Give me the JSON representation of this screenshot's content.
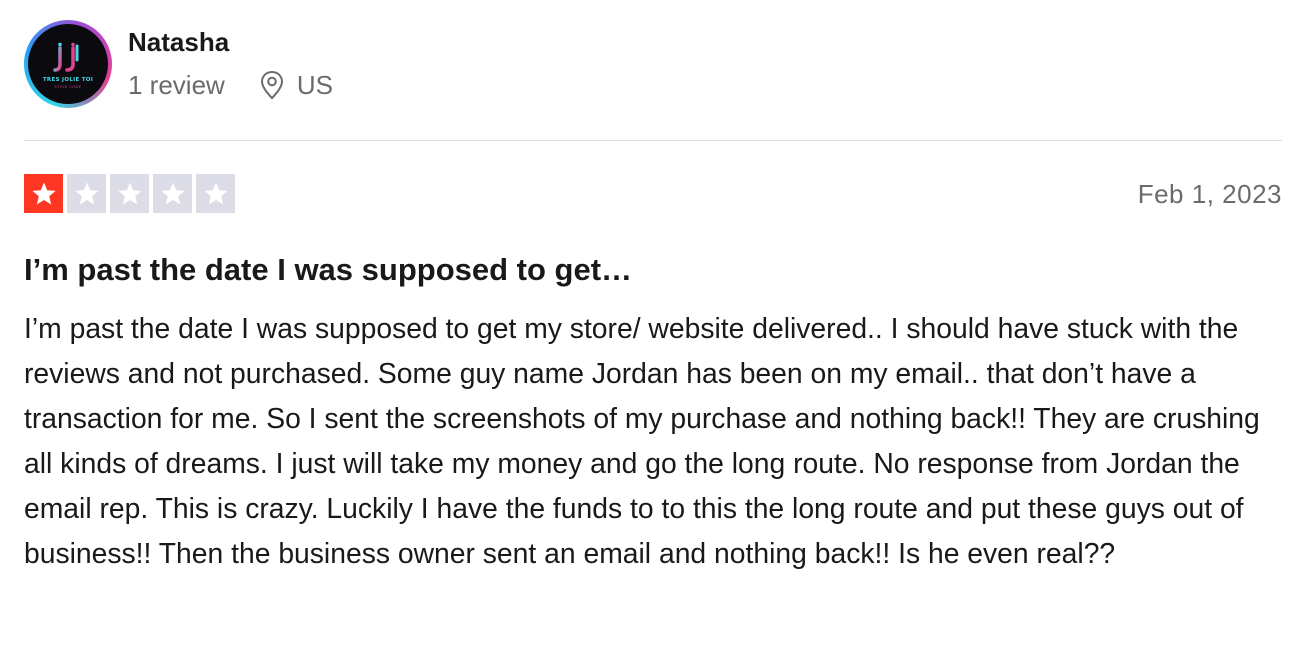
{
  "consumer": {
    "name": "Natasha",
    "review_count": "1 review",
    "country": "US",
    "avatar": {
      "icon": "brand-logo-avatar",
      "brand_text": "TRES JOLIE TOI",
      "sub_text": "STYLE CODE",
      "ring_colors": [
        "#2fd6e6",
        "#2a9df4",
        "#a54bd8",
        "#e53f8f"
      ]
    }
  },
  "review": {
    "rating": 1,
    "rating_max": 5,
    "star_filled_color": "#ff3722",
    "star_empty_color": "#dcdce6",
    "date": "Feb 1, 2023",
    "title": "I’m past the date I was supposed to get…",
    "body": "I’m past the date I was supposed to get my store/ website delivered.. I should have stuck with the reviews and not purchased. Some guy name Jordan has been on my email.. that don’t have a transaction for me. So I sent the screenshots of my purchase and nothing back!! They are crushing all kinds of dreams. I just will take my money and go the long route. No response from Jordan the email rep. This is crazy. Luckily I have the funds to to this the long route and put these guys out of business!! Then the business owner sent an email and nothing back!! Is he even real??"
  },
  "icons": {
    "location": "location-pin-icon",
    "star": "star-icon"
  }
}
